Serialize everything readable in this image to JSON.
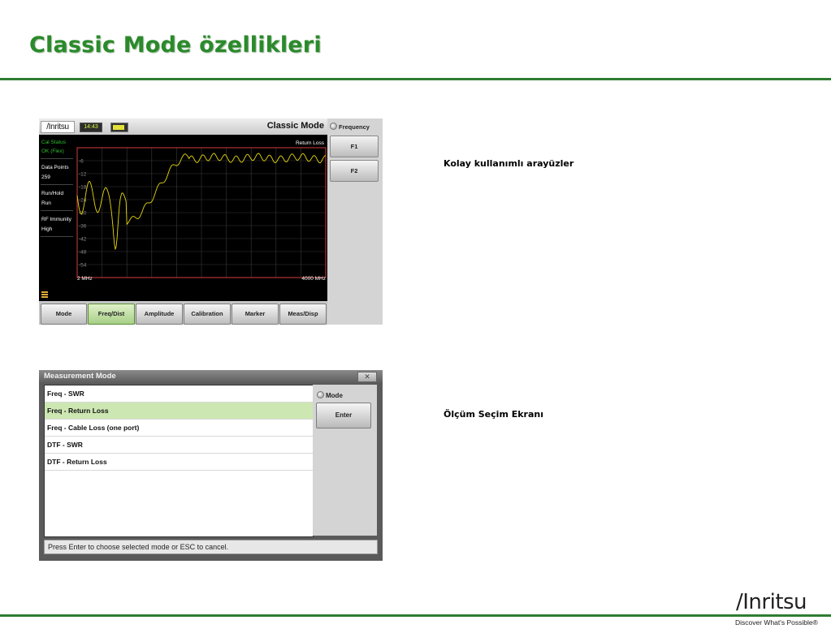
{
  "slide": {
    "title": "Classic Mode özellikleri",
    "caption_1": "Kolay kullanımlı arayüzler",
    "caption_2": "Ölçüm Seçim Ekranı",
    "brand_color": "#2e7d32"
  },
  "instrument": {
    "logo": "/Inritsu",
    "clock": "14:43",
    "title": "Classic Mode",
    "side": {
      "cal_status_label": "Cal Status",
      "cal_status_value": "OK (Flex)",
      "data_points_label": "Data Points",
      "data_points_value": "259",
      "run_hold_label": "Run/Hold",
      "run_hold_value": "Run",
      "rf_immunity_label": "RF Immunity",
      "rf_immunity_value": "High"
    },
    "graph": {
      "title": "Return Loss",
      "start": "2 MHz",
      "stop": "4000 MHz",
      "y_ticks": [
        "-6",
        "-12",
        "-18",
        "-24",
        "-30",
        "-36",
        "-42",
        "-48",
        "-54"
      ],
      "trace_color": "#e8d80a",
      "border_color": "#d23b3b"
    },
    "right_panel": {
      "heading": "Frequency",
      "f1": "F1",
      "f2": "F2"
    },
    "tabs": [
      "Mode",
      "Freq/Dist",
      "Amplitude",
      "Calibration",
      "Marker",
      "Meas/Disp"
    ],
    "active_tab": "Freq/Dist"
  },
  "dialog": {
    "title": "Measurement Mode",
    "close": "✕",
    "items": [
      "Freq - SWR",
      "Freq - Return Loss",
      "Freq - Cable Loss (one port)",
      "DTF - SWR",
      "DTF - Return Loss"
    ],
    "selected": "Freq - Return Loss",
    "mode_label": "Mode",
    "enter": "Enter",
    "status": "Press Enter to choose selected mode or ESC to cancel."
  },
  "footer": {
    "logo": "/Inritsu",
    "tagline": "Discover What's Possible®"
  }
}
